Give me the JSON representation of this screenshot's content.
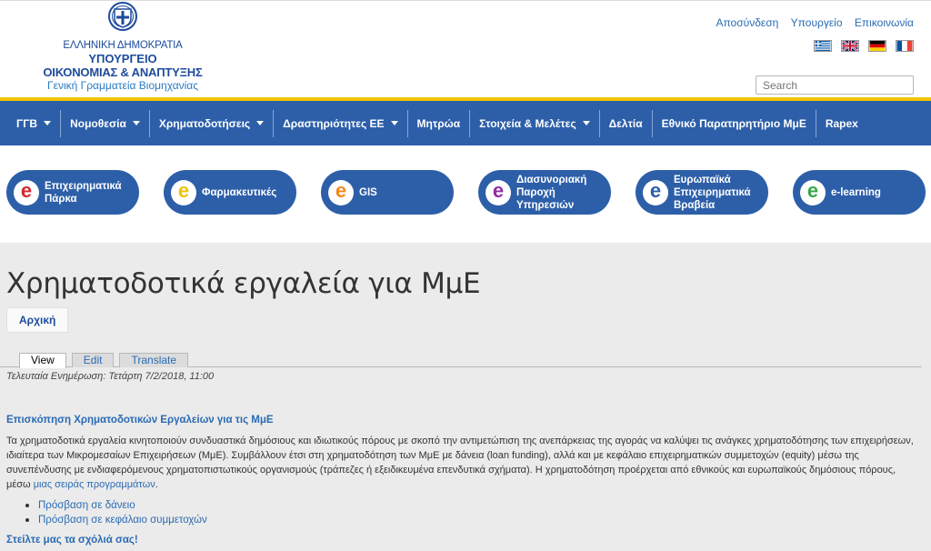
{
  "header": {
    "logo": {
      "line1": "ΕΛΛΗΝΙΚΗ ΔΗΜΟΚΡΑΤΙΑ",
      "line2": "ΥΠΟΥΡΓΕΙΟ",
      "line3": "ΟΙΚΟΝΟΜΙΑΣ & ΑΝΑΠΤΥΞΗΣ",
      "line4": "Γενική Γραμματεία Βιομηχανίας"
    },
    "top_links": [
      "Αποσύνδεση",
      "Υπουργείο",
      "Επικοινωνία"
    ],
    "flags": [
      "greek-flag-icon",
      "uk-flag-icon",
      "german-flag-icon",
      "french-flag-icon"
    ],
    "search": {
      "placeholder": "Search"
    }
  },
  "colors": {
    "brand_blue": "#2d5fa9",
    "accent_yellow": "#f2c200",
    "link_blue": "#2a6bb3"
  },
  "nav": {
    "items": [
      {
        "label": "ΓΓΒ",
        "dropdown": true
      },
      {
        "label": "Νομοθεσία",
        "dropdown": true
      },
      {
        "label": "Χρηματοδοτήσεις",
        "dropdown": true
      },
      {
        "label": "Δραστηριότητες ΕΕ",
        "dropdown": true
      },
      {
        "label": "Μητρώα",
        "dropdown": false
      },
      {
        "label": "Στοιχεία & Μελέτες",
        "dropdown": true
      },
      {
        "label": "Δελτία",
        "dropdown": false
      },
      {
        "label": "Εθνικό Παρατηρητήριο ΜμΕ",
        "dropdown": false
      },
      {
        "label": "Rapex",
        "dropdown": false
      }
    ]
  },
  "services": [
    {
      "label": "Επιχειρηματικά Πάρκα",
      "icon_color": "#d6262f"
    },
    {
      "label": "Φαρμακευτικές",
      "icon_color": "#f2c200"
    },
    {
      "label": "GIS",
      "icon_color": "#f08a1c"
    },
    {
      "label": "Διασυνοριακή Παροχή Υπηρεσιών",
      "icon_color": "#8e2ea8"
    },
    {
      "label": "Ευρωπαϊκά Επιχειρηματικά Βραβεία",
      "icon_color": "#2d5fa9"
    },
    {
      "label": "e-learning",
      "icon_color": "#3aa54a"
    }
  ],
  "main": {
    "title": "Χρηματοδοτικά εργαλεία για ΜμΕ",
    "breadcrumb": "Αρχική",
    "tabs": [
      {
        "label": "View",
        "active": true
      },
      {
        "label": "Edit",
        "active": false
      },
      {
        "label": "Translate",
        "active": false
      }
    ],
    "updated": "Τελευταία Ενημέρωση: Τετάρτη 7/2/2018, 11:00",
    "section_title": "Επισκόπηση Χρηματοδοτικών Εργαλείων για τις ΜμΕ",
    "paragraph": "Τα χρηματοδοτικά εργαλεία κινητοποιούν συνδυαστικά δημόσιους και ιδιωτικούς πόρους με σκοπό την αντιμετώπιση της ανεπάρκειας της αγοράς να καλύψει τις ανάγκες χρηματοδότησης των επιχειρήσεων, ιδιαίτερα των Μικρομεσαίων Επιχειρήσεων (ΜμΕ). Συμβάλλουν έτσι στη χρηματοδότηση των ΜμΕ με δάνεια (loan funding), αλλά και με κεφάλαιο επιχειρηματικών συμμετοχών (equity) μέσω της συνεπένδυσης με ενδιαφερόμενους χρηματοπιστωτικούς οργανισμούς (τράπεζες ή εξειδικευμένα επενδυτικά σχήματα). Η χρηματοδότηση προέρχεται από εθνικούς και ευρωπαϊκούς δημόσιους πόρους, μέσω",
    "paragraph_link": "μιας σειράς προγραμμάτων",
    "paragraph_end": ".",
    "links": [
      "Πρόσβαση σε δάνειο",
      "Πρόσβαση σε κεφάλαιο συμμετοχών"
    ],
    "feedback": "Στείλτε μας τα σχόλιά σας!"
  }
}
